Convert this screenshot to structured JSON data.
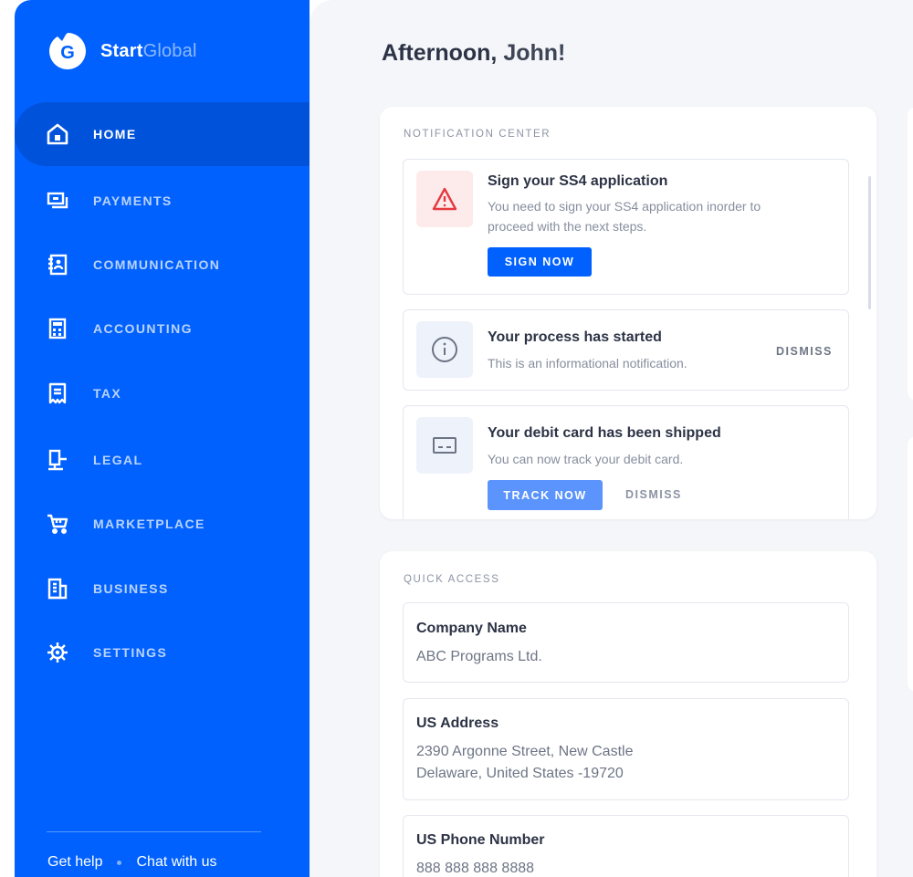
{
  "app": {
    "brand_strong": "Start",
    "brand_light": "Global",
    "logo_letter": "G"
  },
  "sidebar": {
    "items": [
      {
        "label": "HOME",
        "icon": "home-icon",
        "active": true
      },
      {
        "label": "PAYMENTS",
        "icon": "payments-icon",
        "active": false
      },
      {
        "label": "COMMUNICATION",
        "icon": "communication-icon",
        "active": false
      },
      {
        "label": "ACCOUNTING",
        "icon": "calculator-icon",
        "active": false
      },
      {
        "label": "TAX",
        "icon": "receipt-icon",
        "active": false
      },
      {
        "label": "LEGAL",
        "icon": "legal-icon",
        "active": false
      },
      {
        "label": "MARKETPLACE",
        "icon": "cart-icon",
        "active": false
      },
      {
        "label": "BUSINESS",
        "icon": "building-icon",
        "active": false
      },
      {
        "label": "SETTINGS",
        "icon": "gear-icon",
        "active": false
      }
    ],
    "footer": {
      "help": "Get help",
      "chat": "Chat with us"
    }
  },
  "header": {
    "greeting_strong": "Afternoon,",
    "greeting_name": "John!"
  },
  "notifications": {
    "title": "NOTIFICATION CENTER",
    "items": [
      {
        "icon": "warning-icon",
        "title": "Sign your SS4 application",
        "text": "You need to sign your SS4 application inorder to proceed with the next steps.",
        "primary_action": "SIGN NOW"
      },
      {
        "icon": "info-icon",
        "title": "Your process has started",
        "text": "This is an informational notification.",
        "dismiss": "DISMISS"
      },
      {
        "icon": "card-icon",
        "title": "Your debit card has been shipped",
        "text": "You can now track your debit card.",
        "primary_action": "TRACK NOW",
        "dismiss": "DISMISS"
      }
    ]
  },
  "quick_access": {
    "title": "QUICK ACCESS",
    "items": [
      {
        "label": "Company Name",
        "value": "ABC Programs Ltd."
      },
      {
        "label": "US Address",
        "value_line1": "2390  Argonne Street, New Castle",
        "value_line2": "Delaware, United States -19720"
      },
      {
        "label": "US Phone Number",
        "value": "888 888 888 8888"
      }
    ]
  },
  "colors": {
    "brand_blue": "#0161fe",
    "active_nav": "#0152db",
    "danger_bg": "#fdeaea",
    "danger": "#e5393f",
    "info_bg": "#eef2fb"
  }
}
